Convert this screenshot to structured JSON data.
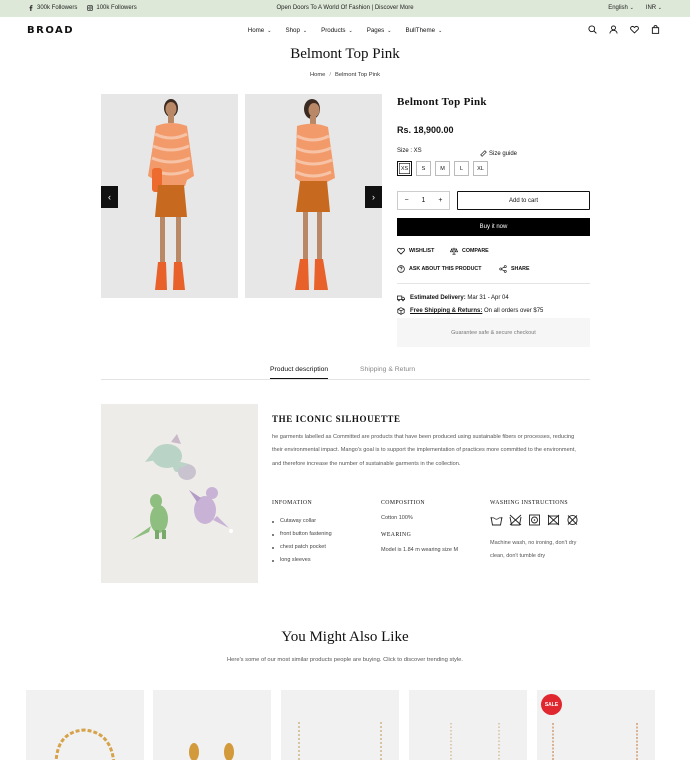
{
  "topbar": {
    "facebook_followers": "300k Followers",
    "instagram_followers": "100k Followers",
    "announcement": "Open Doors To A World Of Fashion | Discover More",
    "language": "English",
    "currency": "INR"
  },
  "header": {
    "logo": "BROAD",
    "nav": [
      "Home",
      "Shop",
      "Products",
      "Pages",
      "BullTheme"
    ]
  },
  "page": {
    "title": "Belmont Top Pink",
    "breadcrumb": [
      "Home",
      "Belmont Top Pink"
    ]
  },
  "product": {
    "name": "Belmont Top Pink",
    "price": "Rs. 18,900.00",
    "size_label": "Size : XS",
    "size_guide": "Size guide",
    "sizes": [
      "XS",
      "S",
      "M",
      "L",
      "XL"
    ],
    "selected_size": "XS",
    "quantity": "1",
    "add_to_cart": "Add to cart",
    "buy_now": "Buy it now",
    "wishlist": "WISHLIST",
    "compare": "COMPARE",
    "ask": "ASK ABOUT THIS PRODUCT",
    "share": "SHARE",
    "delivery_label": "Estimated Delivery:",
    "delivery_value": "Mar 31 - Apr 04",
    "shipping_label": "Free Shipping & Returns:",
    "shipping_value": "On all orders over $75",
    "guarantee": "Guarantee safe & secure checkout"
  },
  "tabs": [
    "Product description",
    "Shipping & Return"
  ],
  "description": {
    "heading": "THE ICONIC SILHOUETTE",
    "text": "he garments labelled as Committed are products that have been produced using sustainable fibers or processes, reducing their environmental impact. Mango's goal is to support the implementation of practices more committed to the environment, and therefore increase the number of sustainable garments in the collection.",
    "infomation_title": "INFOMATION",
    "infomation_items": [
      "Cutaway collar",
      "front button fastening",
      "chest patch pocket",
      "long sleeves"
    ],
    "composition_title": "COMPOSITION",
    "composition_value": "Cotton 100%",
    "wearing_title": "WEARING",
    "wearing_value": "Model is 1.84 m wearing size M",
    "washing_title": "WASHING INSTRUCTIONS",
    "washing_text": "Machine wash, no ironing, don't dry clean, don't tumble dry"
  },
  "also_like": {
    "title": "You Might Also Like",
    "subtitle": "Here's some of our most similar products people are buying. Click to discover trending style.",
    "sale_badge": "SALE"
  },
  "colors": {
    "topbar_bg": "#dde8d8",
    "accent": "#000000",
    "sale": "#e0262e"
  }
}
